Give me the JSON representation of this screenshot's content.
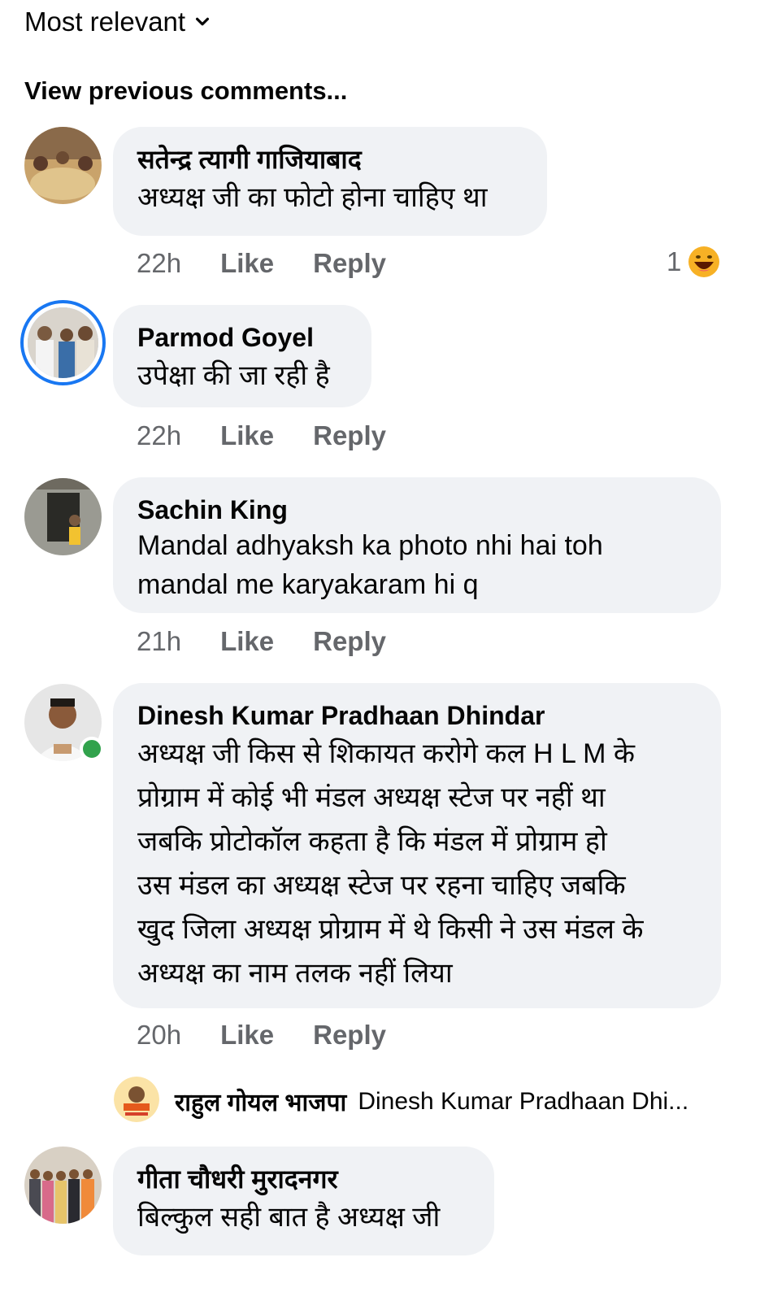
{
  "header": {
    "sort_label": "Most relevant",
    "view_previous": "View previous comments..."
  },
  "comments": [
    {
      "name": "सतेन्द्र त्यागी गाजियाबाद",
      "text": "अध्यक्ष जी का फोटो होना चाहिए था",
      "time": "22h",
      "like": "Like",
      "reply": "Reply",
      "reaction_count": "1"
    },
    {
      "name": "Parmod Goyel",
      "text": "उपेक्षा की जा रही है",
      "time": "22h",
      "like": "Like",
      "reply": "Reply"
    },
    {
      "name": "Sachin King",
      "text_line1": "Mandal adhyaksh ka photo nhi hai toh",
      "text_line2": "mandal me karyakaram hi q",
      "time": "21h",
      "like": "Like",
      "reply": "Reply"
    },
    {
      "name": "Dinesh Kumar Pradhaan Dhindar",
      "lines": [
        "अध्यक्ष जी किस से शिकायत करोगे कल H L M के",
        "प्रोग्राम में कोई भी मंडल अध्यक्ष स्टेज पर नहीं था",
        "जबकि प्रोटोकॉल कहता है कि मंडल में प्रोग्राम हो",
        "उस मंडल का अध्यक्ष स्टेज पर रहना चाहिए जबकि",
        "खुद जिला अध्यक्ष प्रोग्राम में थे किसी ने उस मंडल के",
        "अध्यक्ष का नाम तलक नहीं लिया"
      ],
      "time": "20h",
      "like": "Like",
      "reply": "Reply",
      "reply_preview": {
        "name": "राहुल गोयल भाजपा",
        "text": "Dinesh Kumar Pradhaan Dhi..."
      }
    },
    {
      "name": "गीता चौधरी मुरादनगर",
      "text": "बिल्कुल सही बात है अध्यक्ष जी"
    }
  ],
  "colors": {
    "bubble": "#f0f2f5",
    "meta": "#65676b",
    "ring": "#1877f2",
    "online": "#31a24c"
  },
  "icons": [
    "chevron-down-icon",
    "haha-reaction-icon"
  ]
}
